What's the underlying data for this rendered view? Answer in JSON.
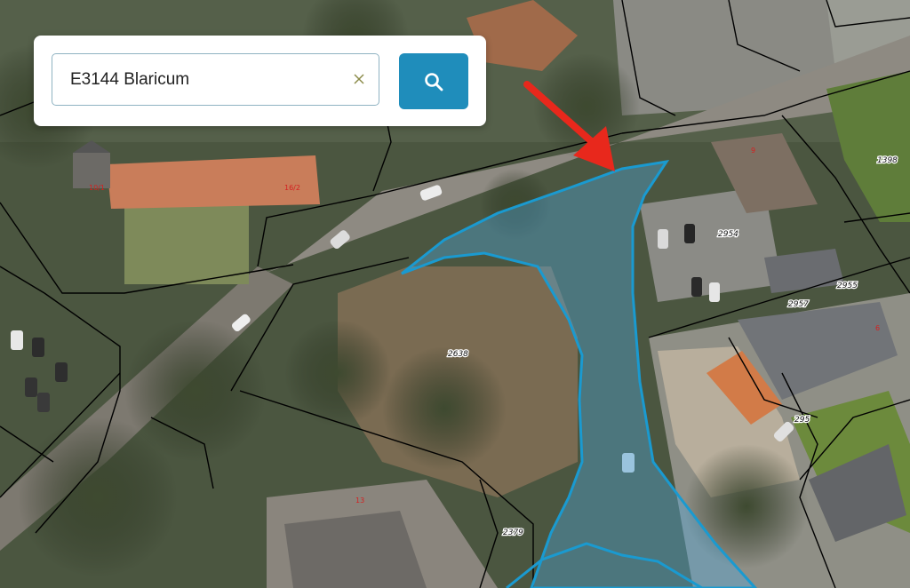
{
  "search": {
    "value": "E3144 Blaricum",
    "clear_icon": "close-icon",
    "button_icon": "search-icon"
  },
  "colors": {
    "parcel_outline": "#1a9ad0",
    "parcel_fill": "rgba(80,170,225,0.38)",
    "boundary_lines": "#000000",
    "arrow": "#e8281c",
    "search_button": "#1f8dbb"
  },
  "parcel_labels": [
    "2638",
    "2954",
    "2955",
    "2957",
    "1398",
    "295",
    "2379"
  ],
  "house_numbers": [
    "10/1",
    "16/2",
    "13",
    "9",
    "6"
  ],
  "highlighted_parcel": "E3144 Blaricum"
}
